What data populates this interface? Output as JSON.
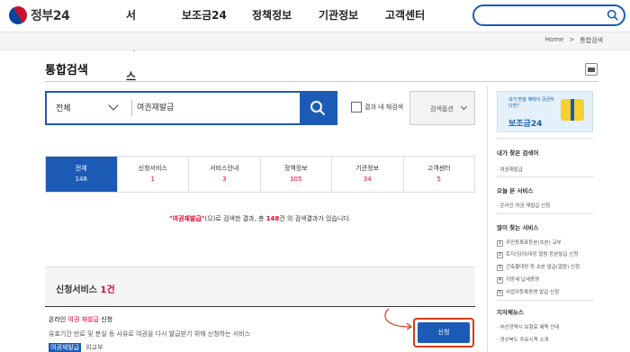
{
  "header": {
    "logo": "정부24",
    "nav": [
      "서비스",
      "보조금24",
      "정책정보",
      "기관정보",
      "고객센터"
    ],
    "search_placeholder": ""
  },
  "breadcrumb": {
    "home": "Home",
    "sep": ">",
    "current": "통합검색"
  },
  "page_title": "통합검색",
  "search": {
    "scope": "전체",
    "query": "여권재발급",
    "within_results_label": "결과 내 재검색",
    "options_label": "검색옵션"
  },
  "tabs": [
    {
      "name": "전체",
      "count": "148"
    },
    {
      "name": "신청서비스",
      "count": "1"
    },
    {
      "name": "서비스안내",
      "count": "3"
    },
    {
      "name": "정책정보",
      "count": "105"
    },
    {
      "name": "기관정보",
      "count": "34"
    },
    {
      "name": "고객센터",
      "count": "5"
    }
  ],
  "result_summary": {
    "keyword": "\"여권재발급\"",
    "middle": "(으)로 검색한 결과, 총 ",
    "total": "148",
    "tail": "건 의 검색결과가 있습니다."
  },
  "section": {
    "title": "신청서비스",
    "count": "1",
    "count_unit": "건"
  },
  "item": {
    "title_prefix": "온라인 ",
    "title_highlight": "여권 재발급",
    "title_suffix": " 신청",
    "description": "유효기간 만료 및 분실 등 사유로 여권을 다시 발급받기 위해 신청하는 서비스",
    "sub_tag": "여권재발급",
    "sub_text": "외교부",
    "apply_label": "신청"
  },
  "sidebar": {
    "banner_line1": "내가 받을 혜택이 궁금하다면?",
    "banner_line2": "보조금24",
    "my_keywords_title": "내가 찾은 검색어",
    "my_keywords": [
      "· 여권재발급"
    ],
    "today_title": "오늘 본 서비스",
    "today_items": [
      "· 온라인 여권 재발급 신청"
    ],
    "popular_title": "많이 찾는 서비스",
    "popular_items": [
      "주민등록표등본(초본) 교부",
      "토지(임야)대장 열람·등본발급 신청",
      "건축물대장 등·초본 발급(열람) 신청",
      "지방세 납세증명",
      "사업자등록증명 발급 신청"
    ],
    "wrap_title": "지자체뉴스",
    "wrap_items": [
      "· 부산광역시 보험료 혜택 안내",
      "· 경상북도 주요시책 소개"
    ]
  }
}
